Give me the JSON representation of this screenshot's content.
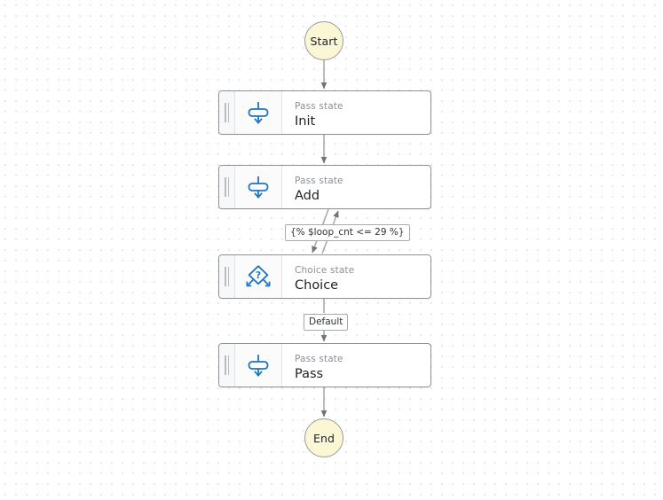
{
  "diagram": {
    "type": "state-machine-workflow",
    "background": "dotted-grid",
    "accent_color": "#1f76c4",
    "terminal_fill": "#fbf6d4",
    "terminal_border": "#9a9a9a",
    "node_border": "#8d9196"
  },
  "nodes": [
    {
      "id": "start",
      "shape": "circle",
      "label": "Start"
    },
    {
      "id": "init",
      "shape": "box",
      "kind": "Pass state",
      "title": "Init",
      "icon": "pass-state-icon"
    },
    {
      "id": "add",
      "shape": "box",
      "kind": "Pass state",
      "title": "Add",
      "icon": "pass-state-icon"
    },
    {
      "id": "choice",
      "shape": "box",
      "kind": "Choice state",
      "title": "Choice",
      "icon": "choice-state-icon"
    },
    {
      "id": "pass",
      "shape": "box",
      "kind": "Pass state",
      "title": "Pass",
      "icon": "pass-state-icon"
    },
    {
      "id": "end",
      "shape": "circle",
      "label": "End"
    }
  ],
  "edges": [
    {
      "from": "start",
      "to": "init",
      "label": ""
    },
    {
      "from": "init",
      "to": "add",
      "label": ""
    },
    {
      "from": "add",
      "to": "choice",
      "label": ""
    },
    {
      "from": "choice",
      "to": "add",
      "label": "{% $loop_cnt <= 29 %}"
    },
    {
      "from": "choice",
      "to": "pass",
      "label": "Default"
    },
    {
      "from": "pass",
      "to": "end",
      "label": ""
    }
  ],
  "labels": {
    "loop_condition": "{% $loop_cnt <= 29 %}",
    "default_branch": "Default"
  }
}
